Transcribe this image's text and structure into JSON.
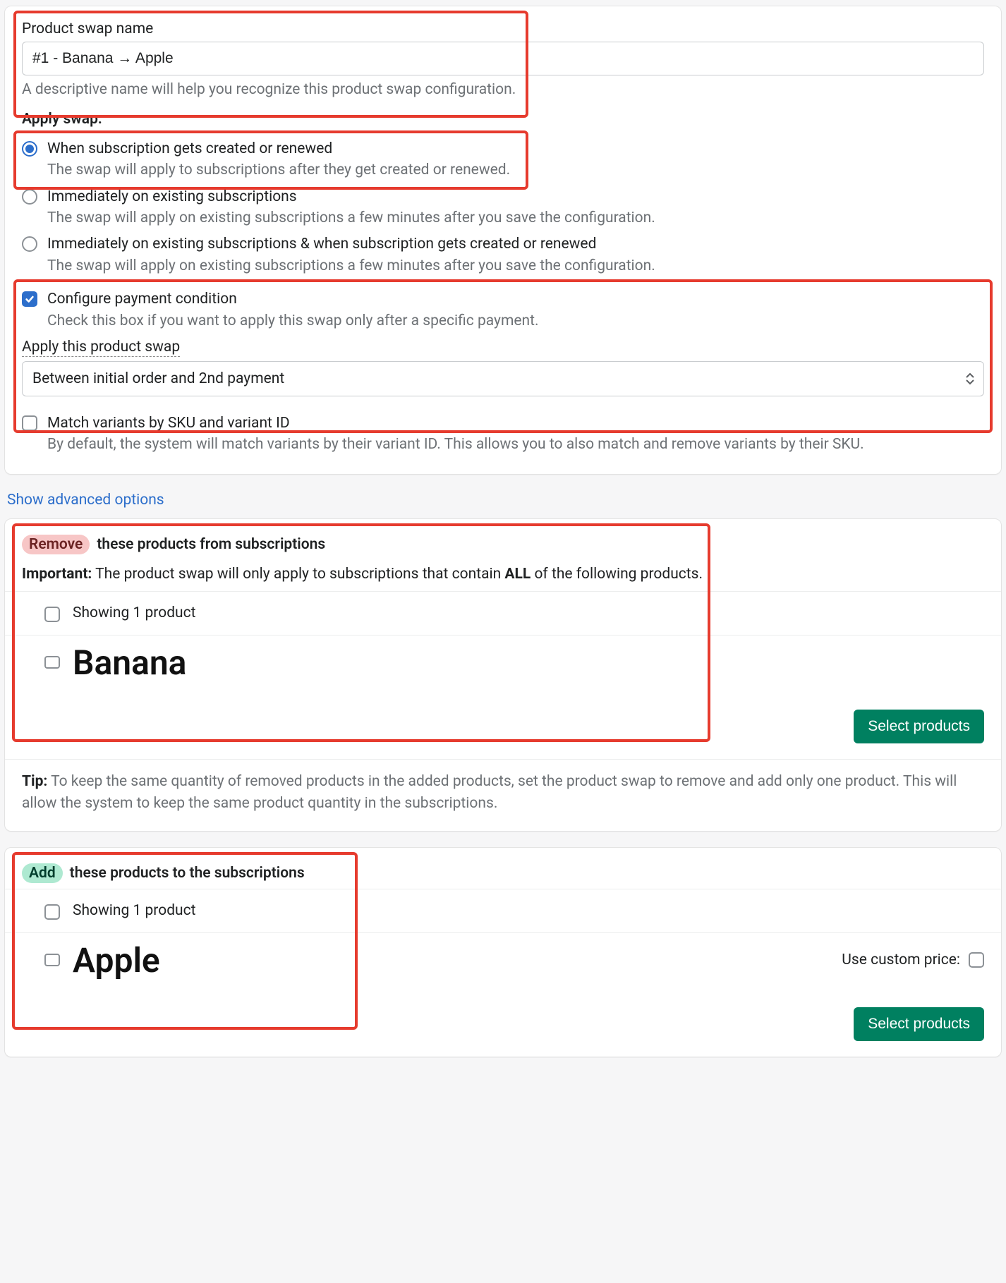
{
  "swapName": {
    "label": "Product swap name",
    "value": "#1 - Banana → Apple",
    "help": "A descriptive name will help you recognize this product swap configuration."
  },
  "applySwap": {
    "label": "Apply swap:",
    "options": [
      {
        "title": "When subscription gets created or renewed",
        "desc": "The swap will apply to subscriptions after they get created or renewed.",
        "selected": true
      },
      {
        "title": "Immediately on existing subscriptions",
        "desc": "The swap will apply on existing subscriptions a few minutes after you save the configuration.",
        "selected": false
      },
      {
        "title": "Immediately on existing subscriptions & when subscription gets created or renewed",
        "desc": "The swap will apply on existing subscriptions a few minutes after you save the configuration.",
        "selected": false
      }
    ]
  },
  "paymentCondition": {
    "checked": true,
    "title": "Configure payment condition",
    "desc": "Check this box if you want to apply this swap only after a specific payment.",
    "fieldLabel": "Apply this product swap",
    "selected": "Between initial order and 2nd payment"
  },
  "matchVariants": {
    "checked": false,
    "title": "Match variants by SKU and variant ID",
    "desc": "By default, the system will match variants by their variant ID. This allows you to also match and remove variants by their SKU."
  },
  "advancedLink": "Show advanced options",
  "removeSection": {
    "pill": "Remove",
    "title": " these products from subscriptions",
    "importantLabel": "Important:",
    "importantText": " The product swap will only apply to subscriptions that contain ",
    "importantBold": "ALL",
    "importantTail": " of the following products.",
    "showing": "Showing 1 product",
    "productName": "Banana",
    "button": "Select products"
  },
  "tip": {
    "label": "Tip:",
    "text": " To keep the same quantity of removed products in the added products, set the product swap to remove and add only one product. This will allow the system to keep the same product quantity in the subscriptions."
  },
  "addSection": {
    "pill": "Add",
    "title": " these products to the subscriptions",
    "showing": "Showing 1 product",
    "productName": "Apple",
    "customPriceLabel": "Use custom price:",
    "button": "Select products"
  }
}
